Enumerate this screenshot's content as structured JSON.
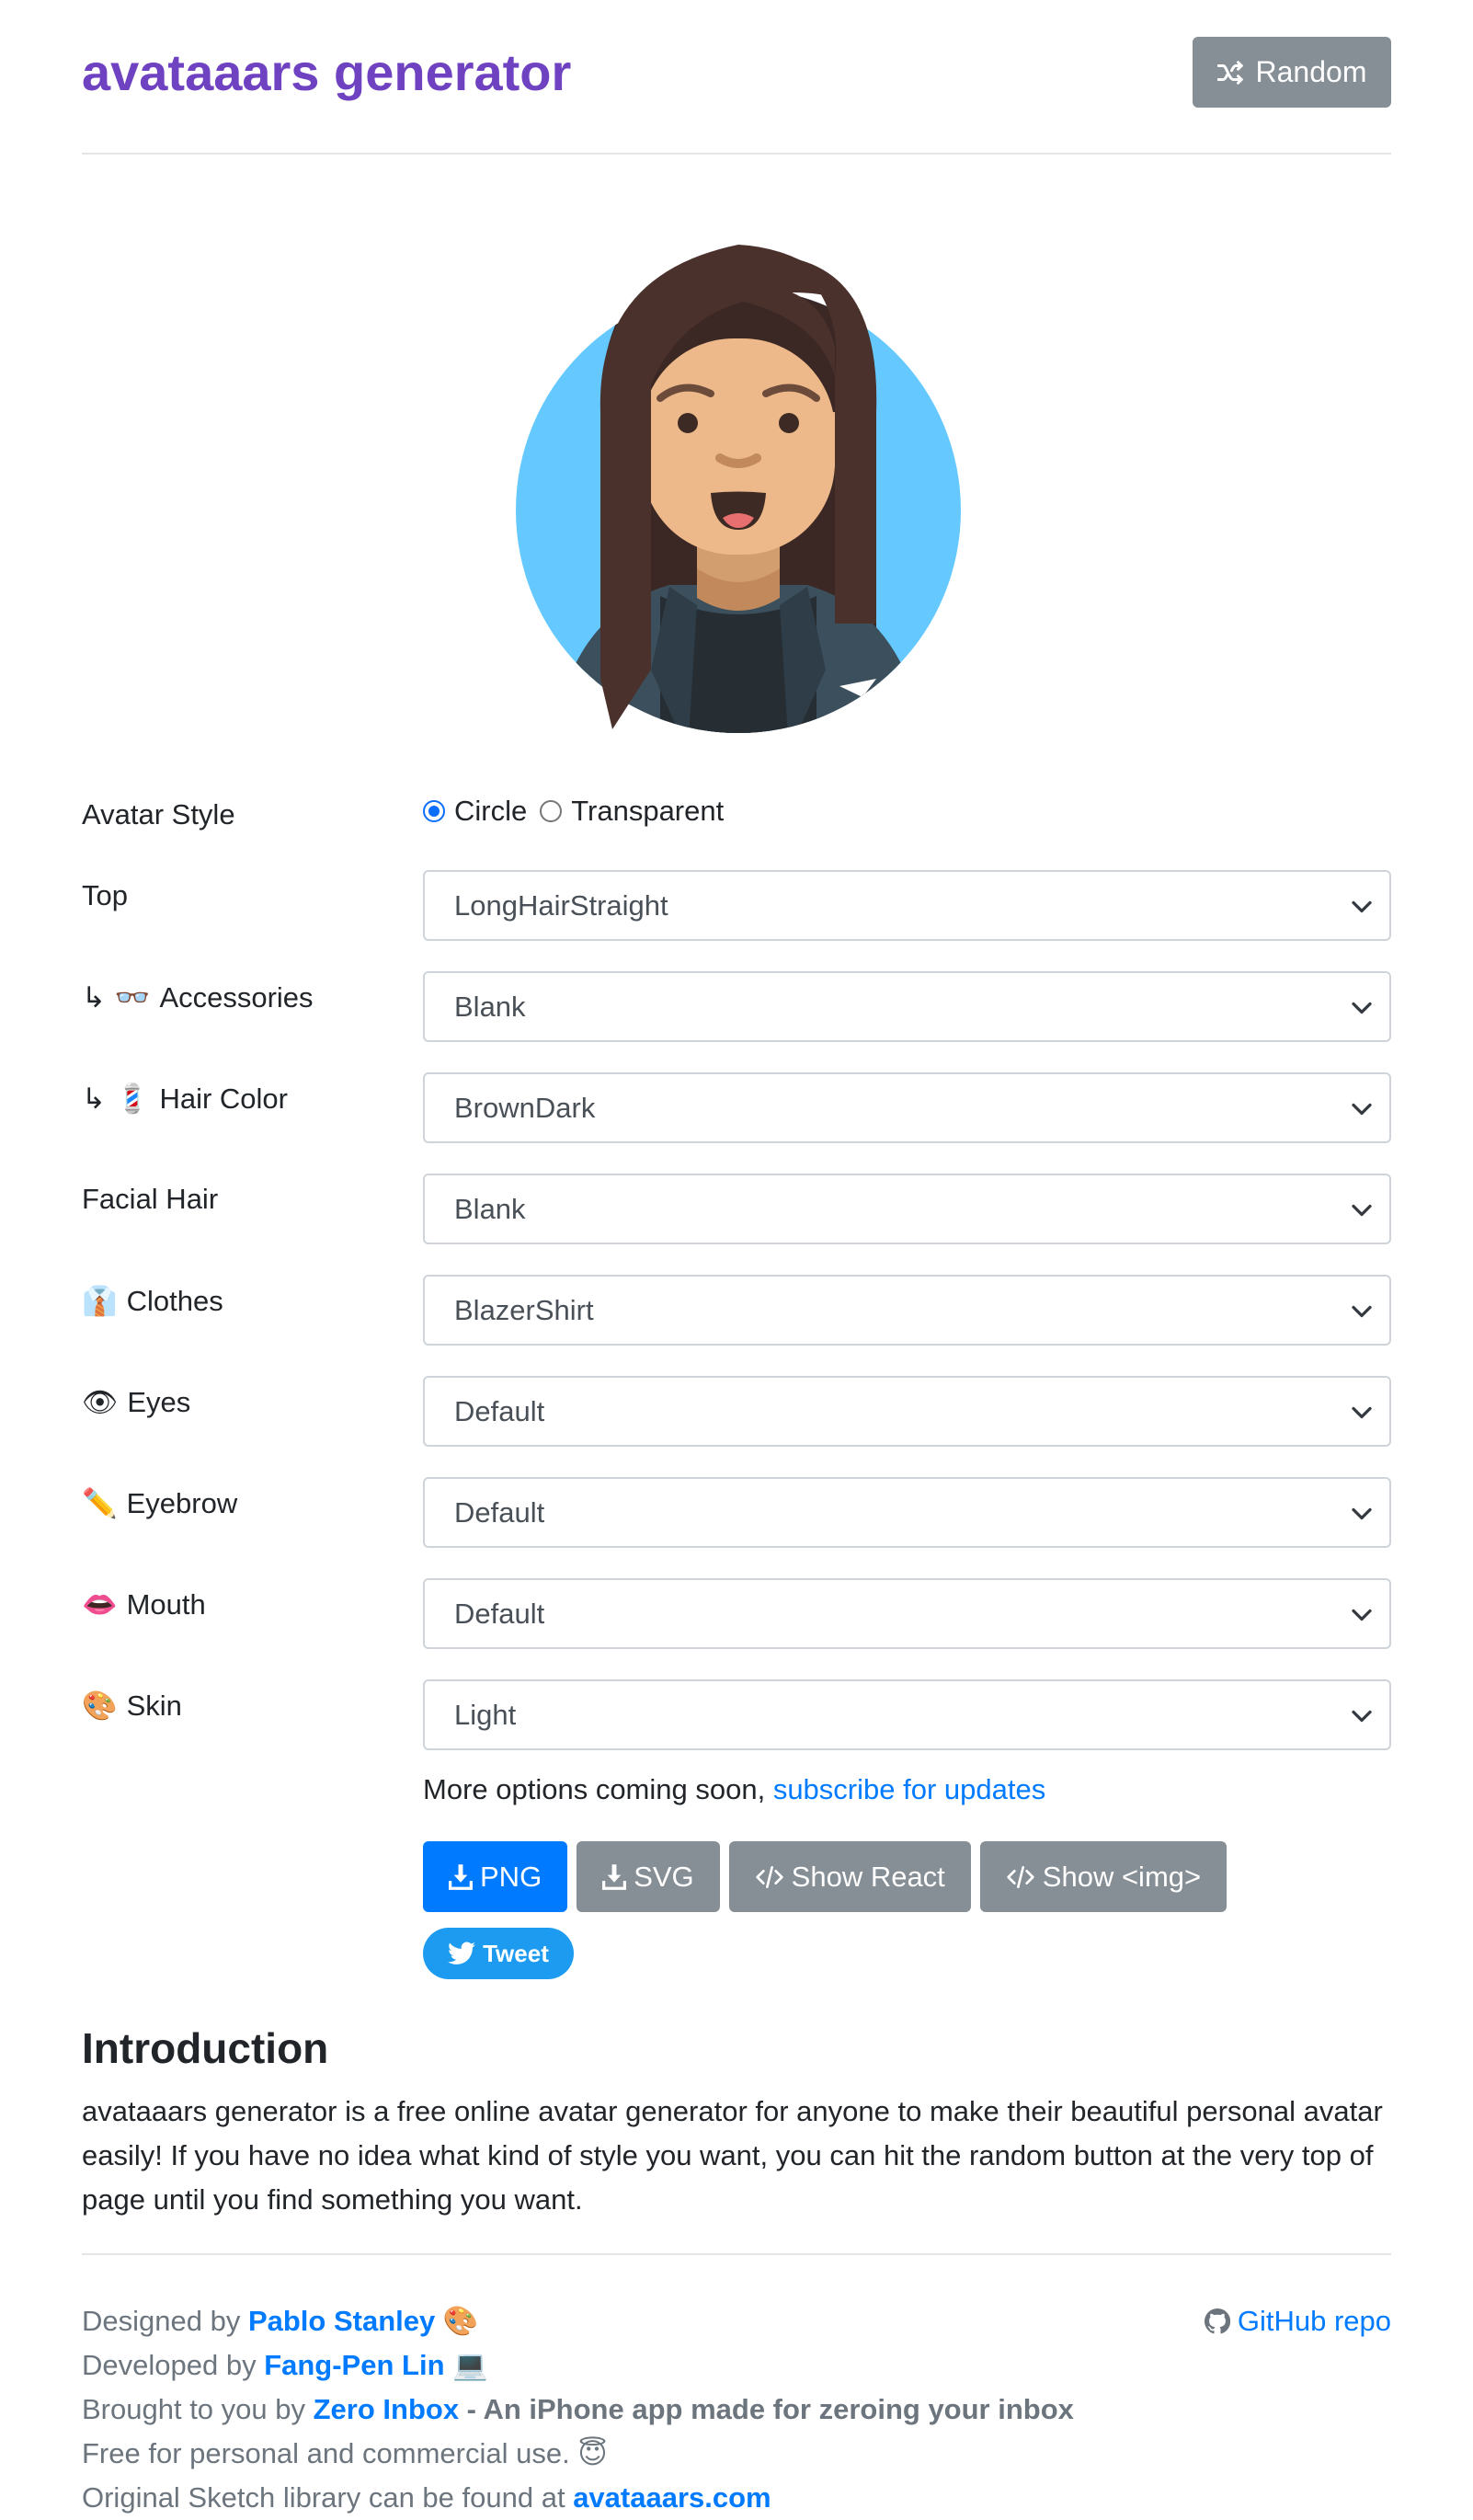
{
  "header": {
    "brand": "avataaars generator",
    "random_label": "Random"
  },
  "colors": {
    "brand": "#6f42c1",
    "primary": "#007bff",
    "secondary": "#868e96",
    "tweet": "#1d9bf0",
    "avatar_bg": "#65c9ff",
    "hair": "#4a312c",
    "skin": "#edb98a",
    "blazer": "#3c4f5c"
  },
  "form": {
    "avatar_style": {
      "label": "Avatar Style",
      "options": [
        "Circle",
        "Transparent"
      ],
      "selected": "Circle"
    },
    "rows": [
      {
        "label": "Top",
        "prefix": "",
        "value": "LongHairStraight"
      },
      {
        "label": "Accessories",
        "prefix": "↳ 👓",
        "value": "Blank"
      },
      {
        "label": "Hair Color",
        "prefix": "↳ 💈",
        "value": "BrownDark"
      },
      {
        "label": "Facial Hair",
        "prefix": "",
        "value": "Blank"
      },
      {
        "label": "Clothes",
        "prefix": "👔",
        "value": "BlazerShirt"
      },
      {
        "label": "Eyes",
        "prefix": "👁",
        "value": "Default"
      },
      {
        "label": "Eyebrow",
        "prefix": "✏️",
        "value": "Default"
      },
      {
        "label": "Mouth",
        "prefix": "👄",
        "value": "Default"
      },
      {
        "label": "Skin",
        "prefix": "🎨",
        "value": "Light"
      }
    ]
  },
  "note": {
    "text": "More options coming soon, ",
    "link": "subscribe for updates"
  },
  "buttons": {
    "png": "PNG",
    "svg": "SVG",
    "react": "Show React",
    "img": "Show <img>",
    "tweet": "Tweet"
  },
  "intro": {
    "title": "Introduction",
    "text": "avataaars generator is a free online avatar generator for anyone to make their beautiful personal avatar easily! If you have no idea what kind of style you want, you can hit the random button at the very top of page until you find something you want."
  },
  "footer": {
    "designed_prefix": "Designed by ",
    "designed_name": "Pablo Stanley",
    "designed_emoji": "🎨",
    "developed_prefix": "Developed by ",
    "developed_name": "Fang-Pen Lin",
    "developed_emoji": "💻",
    "brought_prefix": "Brought to you by ",
    "brought_name": "Zero Inbox",
    "brought_suffix": " - An iPhone app made for zeroing your inbox",
    "free_text": "Free for personal and commercial use.",
    "free_emoji": "😇",
    "original_prefix": "Original Sketch library can be found at ",
    "original_link": "avataaars.com",
    "github": "GitHub repo"
  }
}
